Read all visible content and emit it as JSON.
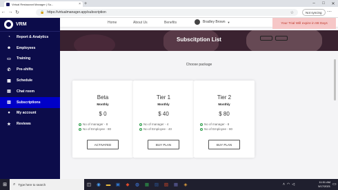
{
  "browser": {
    "tab_title": "Virtual Restaurant Manager | Su...",
    "new_tab": "+",
    "url": "https://virtualmanager.app/subscription",
    "sync_label": "Not syncing",
    "win_min": "–",
    "win_max": "□",
    "win_close": "✕"
  },
  "sidebar": {
    "brand": "VRM",
    "items": [
      {
        "label": "Report & Analytics",
        "icon": "pie-chart-icon",
        "glyph": "◔"
      },
      {
        "label": "Employees",
        "icon": "users-icon",
        "glyph": "☻"
      },
      {
        "label": "Training",
        "icon": "tv-icon",
        "glyph": "▭"
      },
      {
        "label": "Pre-shifts",
        "icon": "megaphone-icon",
        "glyph": "✆"
      },
      {
        "label": "Schedule",
        "icon": "calendar-icon",
        "glyph": "▦"
      },
      {
        "label": "Chat room",
        "icon": "chat-icon",
        "glyph": "▤"
      },
      {
        "label": "Subscriptions",
        "icon": "card-icon",
        "glyph": "▥"
      },
      {
        "label": "My account",
        "icon": "user-icon",
        "glyph": "●"
      },
      {
        "label": "Reviews",
        "icon": "star-icon",
        "glyph": "★"
      }
    ],
    "active_index": 6
  },
  "topnav": {
    "home": "Home",
    "about": "About Us",
    "benefits": "Benefits",
    "user_name": "Bradley Brown",
    "trial": "Your Trial Will expire in 88 Days"
  },
  "page": {
    "title": "Subscitption List",
    "choose": "Choose package"
  },
  "plans": [
    {
      "name": "Beta",
      "period": "Monthly",
      "price": "$ 0",
      "managers": "No of manager - 8",
      "employees": "No of Employee - 80",
      "button": "ACTIVATED"
    },
    {
      "name": "Tier 1",
      "period": "Monthly",
      "price": "$ 40",
      "managers": "No of manager - 4",
      "employees": "No of Employee - 40",
      "button": "BUY PLAN"
    },
    {
      "name": "Tier 2",
      "period": "Monthly",
      "price": "$ 80",
      "managers": "No of manager - 8",
      "employees": "No of Employee - 80",
      "button": "BUY PLAN"
    }
  ],
  "taskbar": {
    "search_placeholder": "Type here to search",
    "time": "11:51 AM",
    "date": "5/17/2021"
  },
  "colors": {
    "sidebar_bg": "#0c0c4a",
    "active_item": "#0000c8",
    "trial_bg": "#f6c7c7",
    "trial_text": "#c0392b",
    "check": "#2e9e4a"
  }
}
